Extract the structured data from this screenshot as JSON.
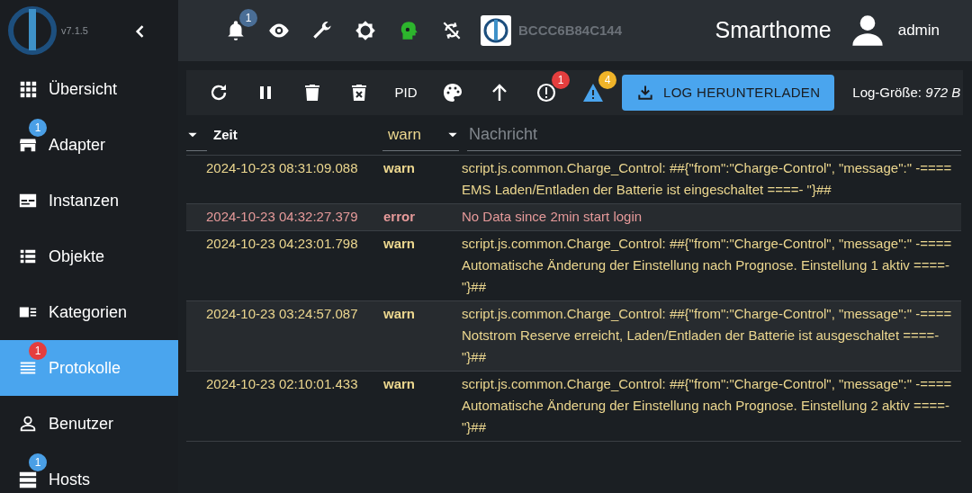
{
  "sidebar": {
    "version": "v7.1.5",
    "items": [
      {
        "kind": "grid",
        "label": "Übersicht",
        "selected": false
      },
      {
        "kind": "store",
        "label": "Adapter",
        "selected": false,
        "badge": {
          "count": "1",
          "color": "#4a9fe6"
        }
      },
      {
        "kind": "card",
        "label": "Instanzen",
        "selected": false
      },
      {
        "kind": "list",
        "label": "Objekte",
        "selected": false
      },
      {
        "kind": "cat",
        "label": "Kategorien",
        "selected": false
      },
      {
        "kind": "lines",
        "label": "Protokolle",
        "selected": true,
        "badge": {
          "count": "1",
          "color": "#e53e3e"
        }
      },
      {
        "kind": "user",
        "label": "Benutzer",
        "selected": false
      },
      {
        "kind": "server",
        "label": "Hosts",
        "selected": false,
        "badge": {
          "count": "1",
          "color": "#4a9fe6"
        }
      }
    ]
  },
  "topbar": {
    "icons": [
      {
        "kind": "bell",
        "badge": {
          "count": "1",
          "color": "#4a6e96"
        }
      },
      {
        "kind": "eye"
      },
      {
        "kind": "wrench"
      },
      {
        "kind": "gear"
      },
      {
        "kind": "head"
      },
      {
        "kind": "sync-off"
      }
    ],
    "host": "BCCC6B84C144",
    "title": "Smarthome",
    "user": "admin"
  },
  "toolbar": {
    "buttons": [
      {
        "kind": "refresh"
      },
      {
        "kind": "pause"
      },
      {
        "kind": "trash"
      },
      {
        "kind": "trash-x"
      },
      {
        "kind": "text",
        "text": "PID"
      },
      {
        "kind": "palette"
      },
      {
        "kind": "arrow-up"
      },
      {
        "kind": "error",
        "badge": {
          "count": "1",
          "color": "#e53e3e"
        }
      },
      {
        "kind": "warning",
        "badge": {
          "count": "4",
          "color": "#f0b429"
        }
      }
    ],
    "download": "LOG HERUNTERLADEN",
    "size": "Log-Größe: *972 B*"
  },
  "filter": {
    "time": "Zeit",
    "level": "warn",
    "placeholder": "Nachricht"
  },
  "rows": [
    {
      "time": "2024-10-23 08:31:09.088",
      "kind": "warn",
      "level": "warn",
      "message": "script.js.common.Charge_Control: ##{\"from\":\"Charge-Control\", \"message\":\" -==== EMS Laden/Entladen der Batterie ist eingeschaltet ====- \"}##"
    },
    {
      "time": "2024-10-23 04:32:27.379",
      "kind": "error",
      "level": "error",
      "message": "No Data since 2min start login"
    },
    {
      "time": "2024-10-23 04:23:01.798",
      "kind": "warn",
      "level": "warn",
      "message": "script.js.common.Charge_Control: ##{\"from\":\"Charge-Control\", \"message\":\" -==== Automatische Änderung der Einstellung nach Prognose. Einstellung 1 aktiv ====- \"}##"
    },
    {
      "time": "2024-10-23 03:24:57.087",
      "kind": "warn",
      "level": "warn",
      "message": "script.js.common.Charge_Control: ##{\"from\":\"Charge-Control\", \"message\":\" -==== Notstrom Reserve erreicht, Laden/Entladen der Batterie ist ausgeschaltet ====- \"}##"
    },
    {
      "time": "2024-10-23 02:10:01.433",
      "kind": "warn",
      "level": "warn",
      "message": "script.js.common.Charge_Control: ##{\"from\":\"Charge-Control\", \"message\":\" -==== Automatische Änderung der Einstellung nach Prognose. Einstellung 2 aktiv ====- \"}##"
    }
  ]
}
